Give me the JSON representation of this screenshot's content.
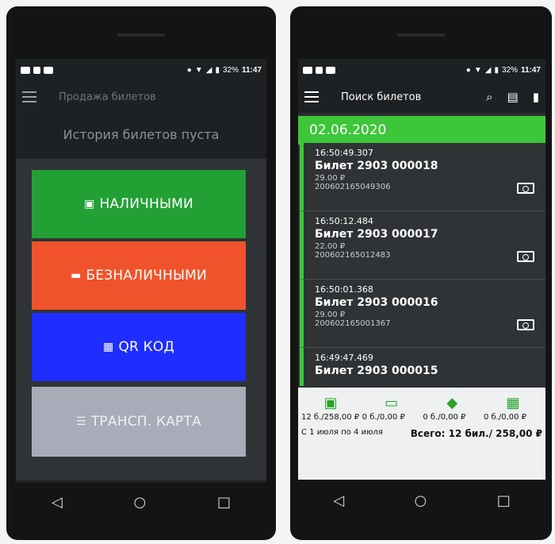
{
  "status": {
    "battery": "32%",
    "time": "11:47"
  },
  "left": {
    "title": "Продажа билетов",
    "empty_message": "История билетов пуста",
    "buttons": {
      "cash": "НАЛИЧНЫМИ",
      "card": "БЕЗНАЛИЧНЫМИ",
      "qr": "QR КОД",
      "transport": "ТРАНСП. КАРТА"
    },
    "colors": {
      "cash": "#23a034",
      "card": "#f0532b",
      "qr": "#1f2dff",
      "transport": "#a7acb8"
    }
  },
  "right": {
    "title": "Поиск билетов",
    "date": "02.06.2020",
    "tickets": [
      {
        "time": "16:50:49.307",
        "title": "Билет 2903 000018",
        "price": "29.00 ₽",
        "code": "200602165049306"
      },
      {
        "time": "16:50:12.484",
        "title": "Билет 2903 000017",
        "price": "22.00 ₽",
        "code": "200602165012483"
      },
      {
        "time": "16:50:01.368",
        "title": "Билет 2903 000016",
        "price": "29.00 ₽",
        "code": "200602165001367"
      },
      {
        "time": "16:49:47.469",
        "title": "Билет 2903 000015",
        "price": "",
        "code": ""
      }
    ],
    "summary": {
      "cols": [
        "12 б./258,00 ₽",
        "0 б./0,00 ₽",
        "0 б./0,00 ₽",
        "0 б./0,00 ₽"
      ],
      "period": "С 1 июля по 4 июля",
      "total": "Всего: 12 бил./ 258,00 ₽"
    },
    "accent": "#3ec63a"
  },
  "nav": {
    "back": "◁",
    "home": "○",
    "recent": "□"
  }
}
